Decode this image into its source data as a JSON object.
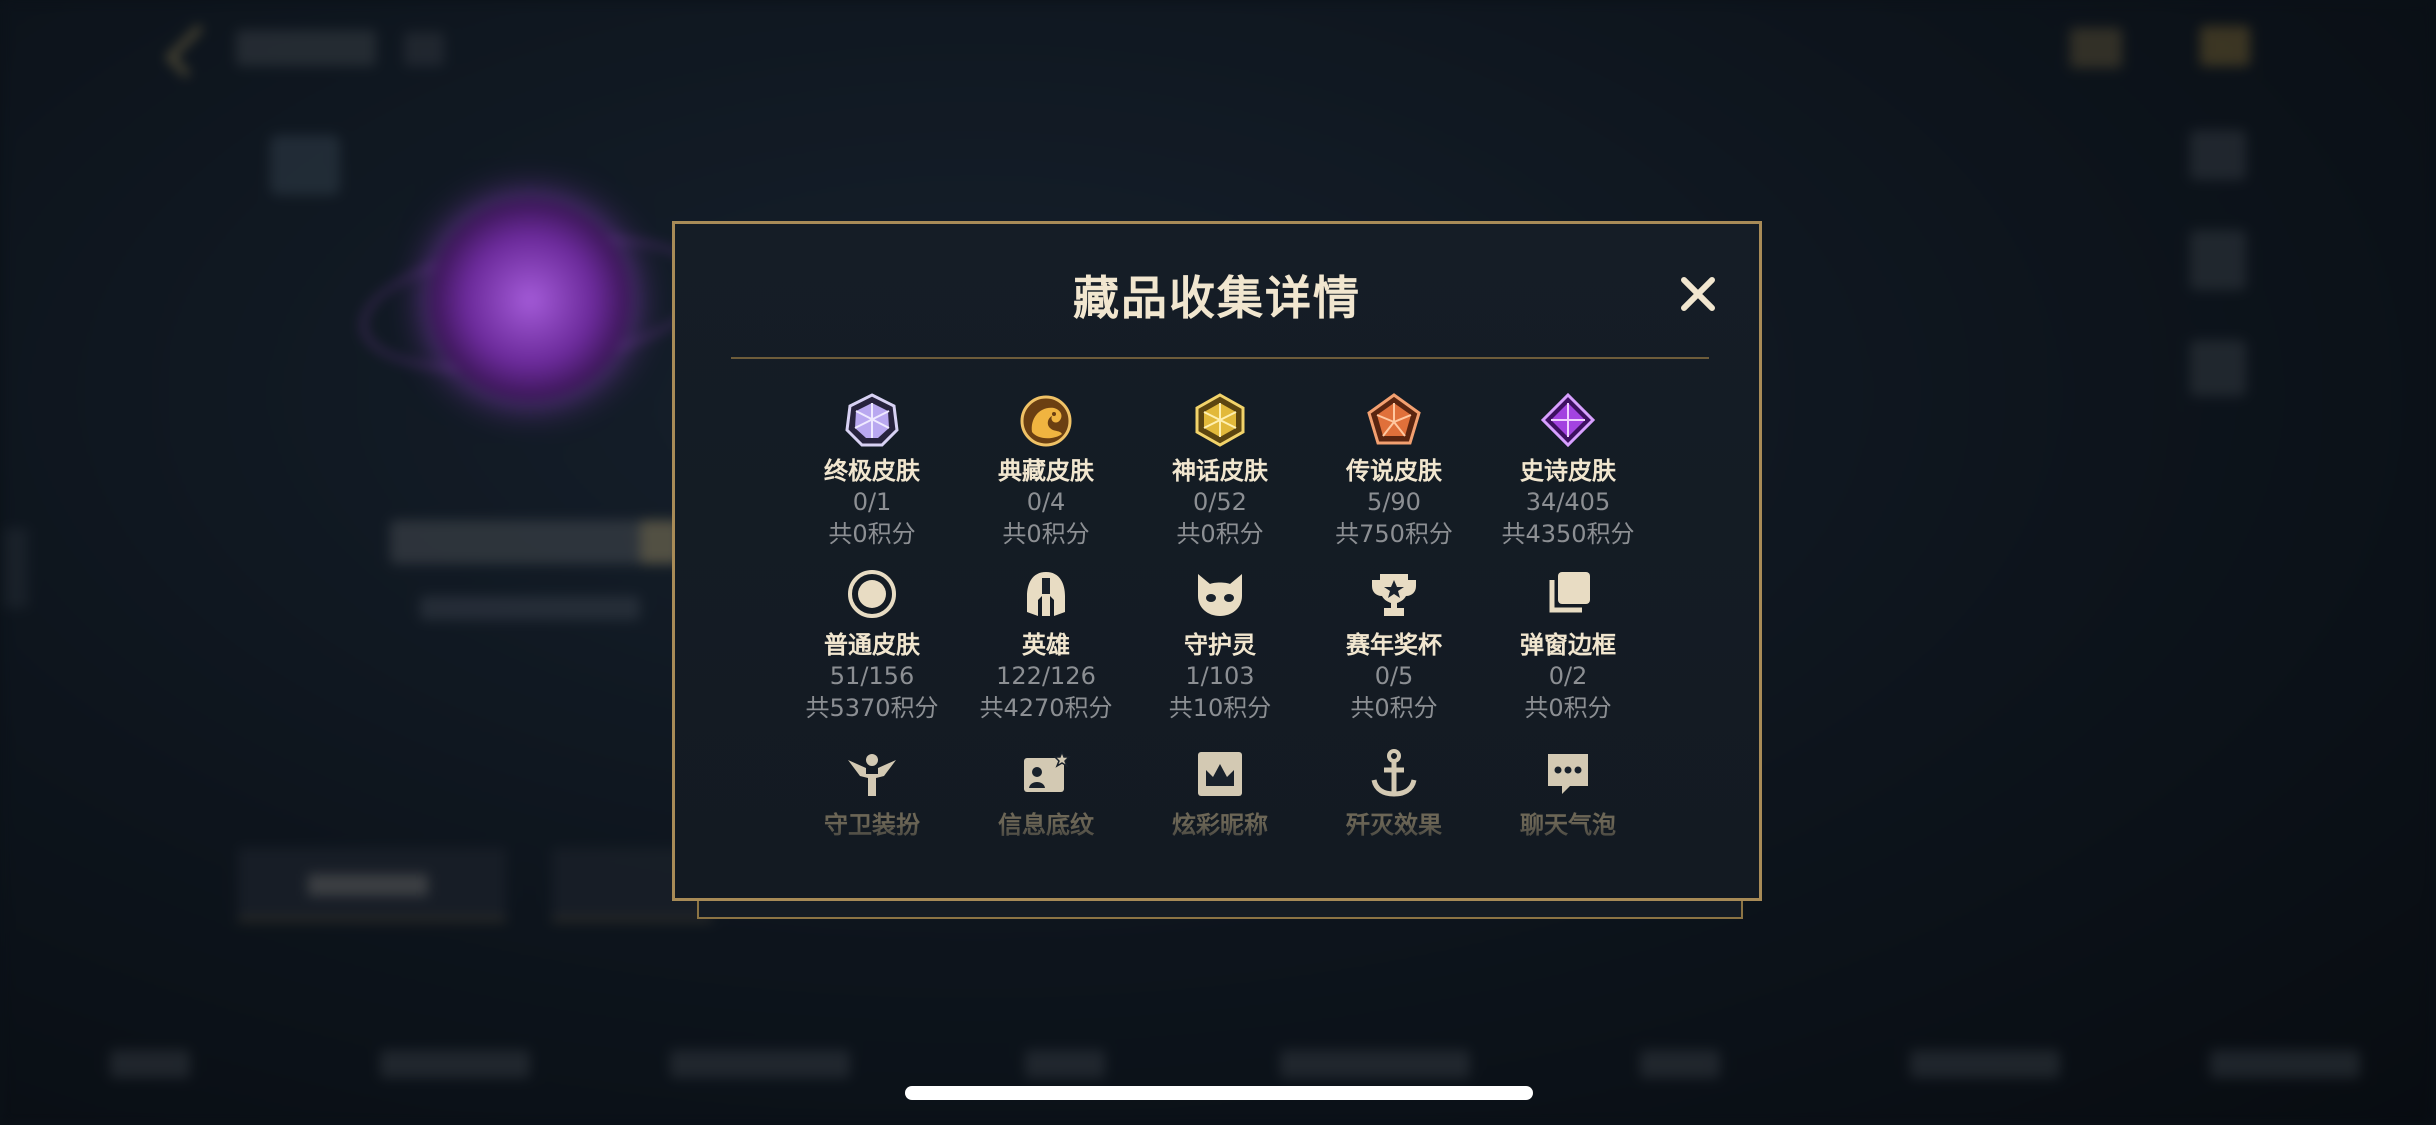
{
  "modal": {
    "title": "藏品收集详情",
    "close_icon": "close-icon",
    "rows": [
      [
        {
          "icon": "ultimate-skin-gem-icon",
          "name": "终极皮肤",
          "count": "0/1",
          "points": "共0积分",
          "color": "#b9a8f0"
        },
        {
          "icon": "prestige-skin-dragon-icon",
          "name": "典藏皮肤",
          "count": "0/4",
          "points": "共0积分",
          "color": "#d49a3a"
        },
        {
          "icon": "mythic-skin-gem-icon",
          "name": "神话皮肤",
          "count": "0/52",
          "points": "共0积分",
          "color": "#e2b93a"
        },
        {
          "icon": "legendary-skin-gem-icon",
          "name": "传说皮肤",
          "count": "5/90",
          "points": "共750积分",
          "color": "#e0703a"
        },
        {
          "icon": "epic-skin-gem-icon",
          "name": "史诗皮肤",
          "count": "34/405",
          "points": "共4350积分",
          "color": "#a343e0"
        }
      ],
      [
        {
          "icon": "common-skin-circle-icon",
          "name": "普通皮肤",
          "count": "51/156",
          "points": "共5370积分"
        },
        {
          "icon": "champion-helmet-icon",
          "name": "英雄",
          "count": "122/126",
          "points": "共4270积分"
        },
        {
          "icon": "guardian-pet-icon",
          "name": "守护灵",
          "count": "1/103",
          "points": "共10积分"
        },
        {
          "icon": "season-trophy-icon",
          "name": "赛年奖杯",
          "count": "0/5",
          "points": "共0积分"
        },
        {
          "icon": "popup-frame-icon",
          "name": "弹窗边框",
          "count": "0/2",
          "points": "共0积分"
        }
      ],
      [
        {
          "icon": "ward-skin-icon",
          "name": "守卫装扮"
        },
        {
          "icon": "profile-banner-icon",
          "name": "信息底纹"
        },
        {
          "icon": "colorful-nickname-crown-icon",
          "name": "炫彩昵称"
        },
        {
          "icon": "elimination-effect-anchor-icon",
          "name": "歼灭效果"
        },
        {
          "icon": "chat-bubble-icon",
          "name": "聊天气泡"
        }
      ]
    ]
  }
}
